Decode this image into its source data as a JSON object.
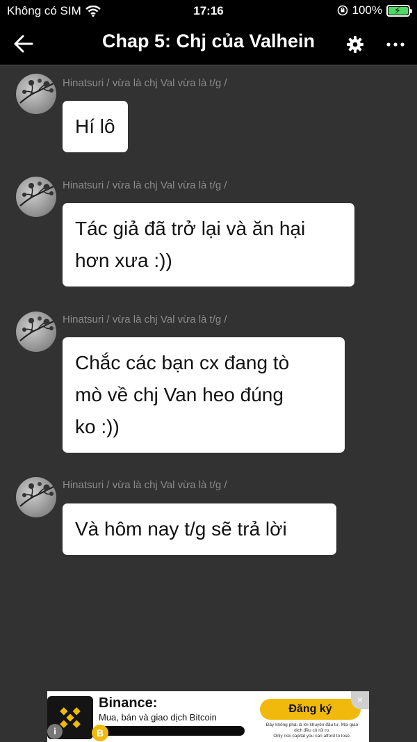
{
  "status_bar": {
    "carrier": "Không có SIM",
    "time": "17:16",
    "battery": "100%"
  },
  "header": {
    "title": "Chap 5: Chj của Valhein"
  },
  "messages": [
    {
      "author": "Hinatsuri / vừa là chj Val vừa là t/g /",
      "lines": [
        "Hí lô"
      ]
    },
    {
      "author": "Hinatsuri / vừa là chj Val vừa là t/g /",
      "lines": [
        "Tác giả đã trở lại và ăn hại",
        "hơn xưa :))"
      ]
    },
    {
      "author": "Hinatsuri / vừa là chj Val vừa là t/g /",
      "lines": [
        "Chắc các bạn cx đang tò",
        "mò về chj Van heo đúng",
        "ko :))"
      ]
    },
    {
      "author": "Hinatsuri / vừa là chj Val vừa là t/g /",
      "lines": [
        "Và hôm nay t/g sẽ trả lời"
      ]
    }
  ],
  "ad": {
    "brand": "Binance:",
    "tagline": "Mua, bán và giao dịch Bitcoin",
    "coin_symbol": "B",
    "cta": "Đăng ký",
    "disclaimer_lines": [
      "Đây không phải là lời khuyên đầu tư. Mọi giao",
      "dịch đều có rủi ro.",
      "Only risk capital you can afford to lose."
    ],
    "close_symbol": "×",
    "info_symbol": "i"
  },
  "colors": {
    "background": "#323232",
    "bar": "#000000",
    "bubble": "#ffffff",
    "author_text": "#8b8b8b",
    "accent": "#f0b90b"
  }
}
